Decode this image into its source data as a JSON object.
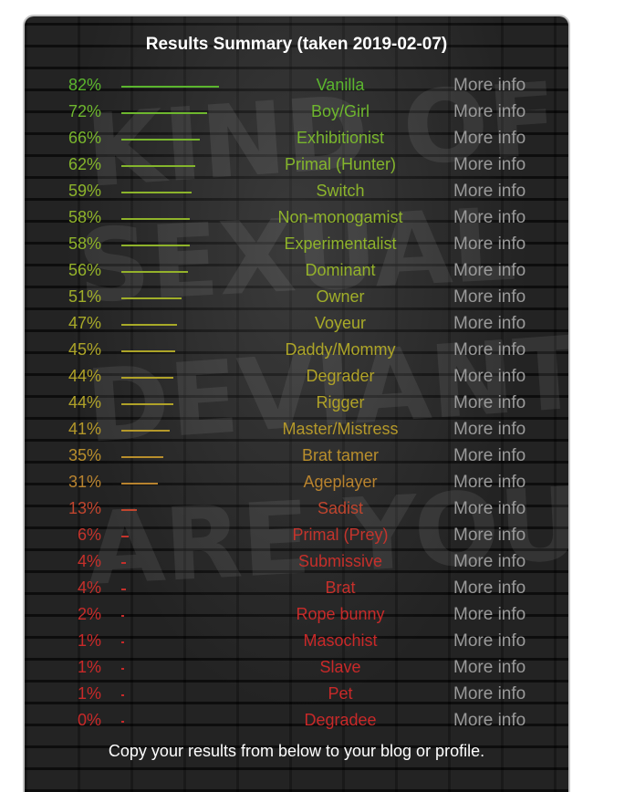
{
  "title": "Results Summary (taken 2019-02-07)",
  "more_info_label": "More info",
  "footer": "Copy your results from below to your blog or profile.",
  "results": [
    {
      "pct": 82,
      "label": "82%",
      "name": "Vanilla",
      "color": "#5bb62e"
    },
    {
      "pct": 72,
      "label": "72%",
      "name": "Boy/Girl",
      "color": "#6eb72e"
    },
    {
      "pct": 66,
      "label": "66%",
      "name": "Exhibitionist",
      "color": "#79b62d"
    },
    {
      "pct": 62,
      "label": "62%",
      "name": "Primal (Hunter)",
      "color": "#84b52c"
    },
    {
      "pct": 59,
      "label": "59%",
      "name": "Switch",
      "color": "#8cb42b"
    },
    {
      "pct": 58,
      "label": "58%",
      "name": "Non-monogamist",
      "color": "#8fb32b"
    },
    {
      "pct": 58,
      "label": "58%",
      "name": "Experimentalist",
      "color": "#8fb32b"
    },
    {
      "pct": 56,
      "label": "56%",
      "name": "Dominant",
      "color": "#94b22a"
    },
    {
      "pct": 51,
      "label": "51%",
      "name": "Owner",
      "color": "#a0ae29"
    },
    {
      "pct": 47,
      "label": "47%",
      "name": "Voyeur",
      "color": "#a8aa28"
    },
    {
      "pct": 45,
      "label": "45%",
      "name": "Daddy/Mommy",
      "color": "#ada528"
    },
    {
      "pct": 44,
      "label": "44%",
      "name": "Degrader",
      "color": "#b0a228"
    },
    {
      "pct": 44,
      "label": "44%",
      "name": "Rigger",
      "color": "#b0a228"
    },
    {
      "pct": 41,
      "label": "41%",
      "name": "Master/Mistress",
      "color": "#b4982a"
    },
    {
      "pct": 35,
      "label": "35%",
      "name": "Brat tamer",
      "color": "#b88e2c"
    },
    {
      "pct": 31,
      "label": "31%",
      "name": "Ageplayer",
      "color": "#b8832f"
    },
    {
      "pct": 13,
      "label": "13%",
      "name": "Sadist",
      "color": "#c0452e"
    },
    {
      "pct": 6,
      "label": "6%",
      "name": "Primal (Prey)",
      "color": "#c4342c"
    },
    {
      "pct": 4,
      "label": "4%",
      "name": "Submissive",
      "color": "#c6302b"
    },
    {
      "pct": 4,
      "label": "4%",
      "name": "Brat",
      "color": "#c6302b"
    },
    {
      "pct": 2,
      "label": "2%",
      "name": "Rope bunny",
      "color": "#c82b2a"
    },
    {
      "pct": 1,
      "label": "1%",
      "name": "Masochist",
      "color": "#c92929"
    },
    {
      "pct": 1,
      "label": "1%",
      "name": "Slave",
      "color": "#c92929"
    },
    {
      "pct": 1,
      "label": "1%",
      "name": "Pet",
      "color": "#c92929"
    },
    {
      "pct": 0,
      "label": "0%",
      "name": "Degradee",
      "color": "#c92929"
    }
  ]
}
